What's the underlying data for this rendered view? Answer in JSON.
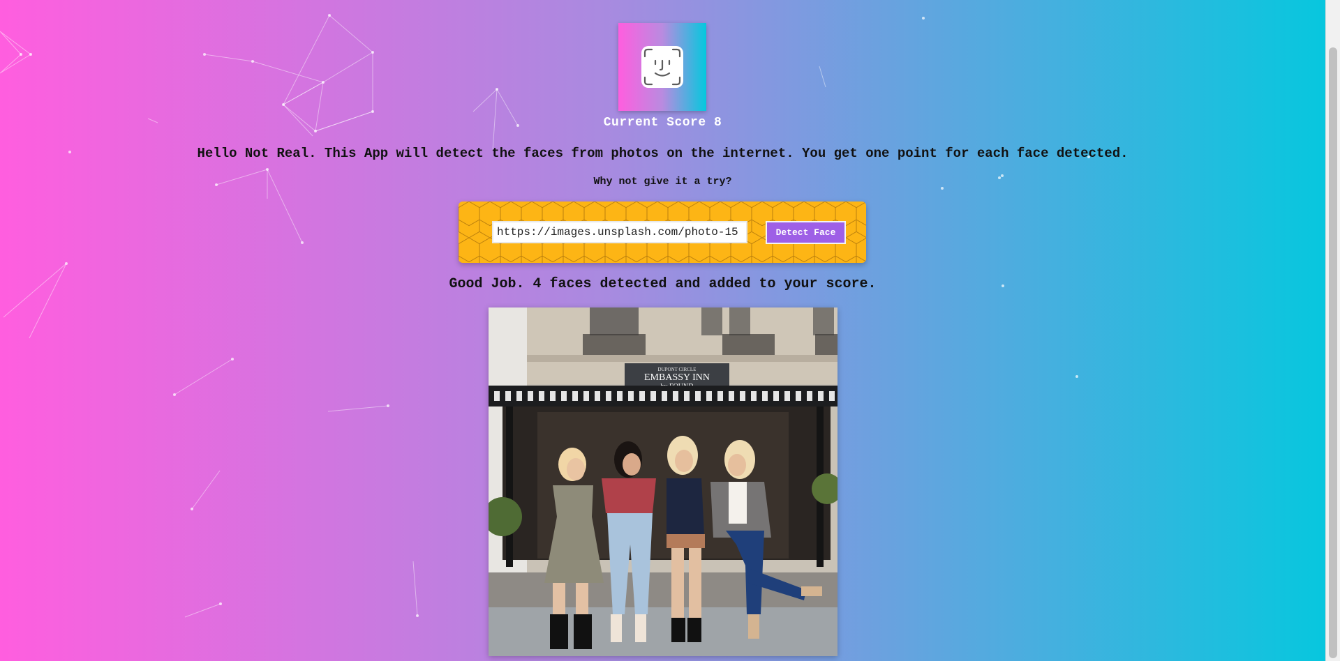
{
  "header": {
    "logo_icon": "face-id-icon",
    "score_label": "Current Score 8"
  },
  "intro_text": "Hello Not Real. This App will detect the faces from photos on the internet. You get one point for each face detected.",
  "prompt_text": "Why not give it a try?",
  "form": {
    "url_value": "https://images.unsplash.com/photo-15",
    "button_label": "Detect Face"
  },
  "result_text": "Good Job. 4 faces detected and added to your score.",
  "photo": {
    "sign_line1": "DUPONT CIRCLE",
    "sign_line2": "EMBASSY INN",
    "sign_line3": "by FOUND"
  },
  "colors": {
    "gradient_left": "#ff5edf",
    "gradient_right": "#04c8de",
    "panel": "#fdb515",
    "button": "#9e5fe6"
  }
}
